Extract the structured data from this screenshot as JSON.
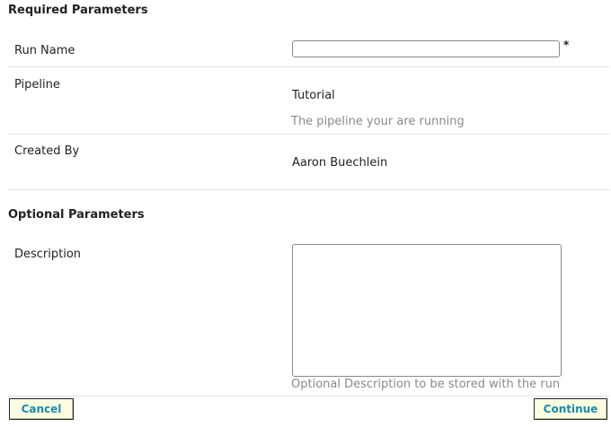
{
  "required": {
    "title": "Required Parameters",
    "run_name": {
      "label": "Run Name",
      "value": "",
      "required_marker": "*"
    },
    "pipeline": {
      "label": "Pipeline",
      "value": "Tutorial",
      "hint": "The pipeline your are running"
    },
    "created_by": {
      "label": "Created By",
      "value": "Aaron Buechlein"
    }
  },
  "optional": {
    "title": "Optional Parameters",
    "description": {
      "label": "Description",
      "value": "",
      "hint": "Optional Description to be stored with the run"
    }
  },
  "buttons": {
    "cancel": "Cancel",
    "continue": "Continue"
  },
  "colors": {
    "button_bg": "#fdfde0",
    "button_text": "#1a8ab0",
    "hint_text": "#8a8a8a"
  }
}
